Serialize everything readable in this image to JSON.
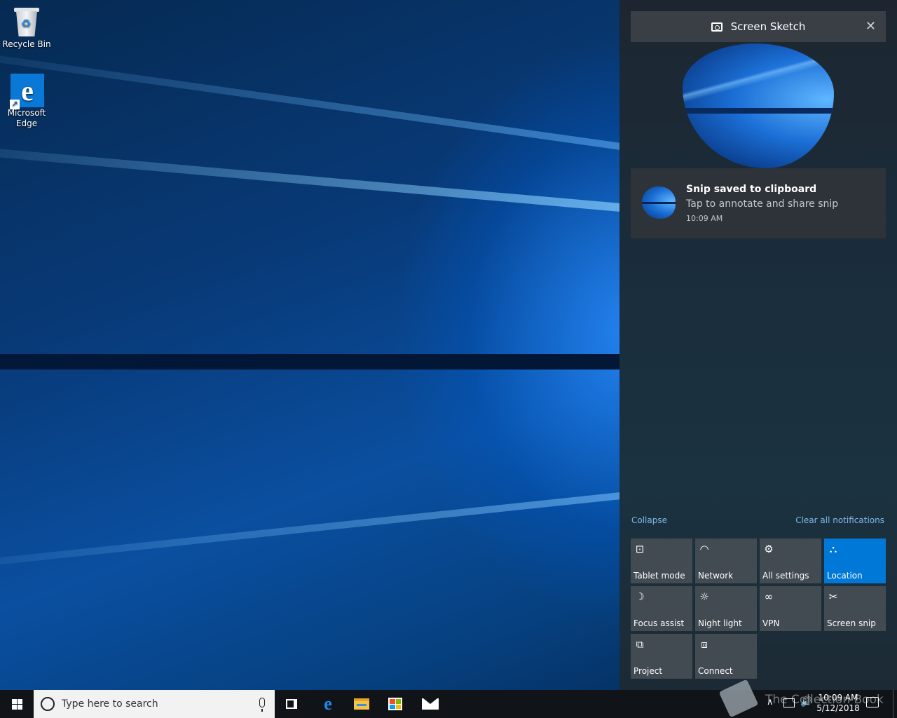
{
  "desktop": {
    "icons": [
      {
        "label": "Recycle Bin"
      },
      {
        "label": "Microsoft\nEdge"
      }
    ]
  },
  "action_center": {
    "group": {
      "app_name": "Screen Sketch",
      "close_glyph": "✕"
    },
    "toast": {
      "title": "Snip saved to clipboard",
      "body": "Tap to annotate and share snip",
      "time": "10:09 AM"
    },
    "collapse_label": "Collapse",
    "clear_all_label": "Clear all notifications",
    "quick_actions": [
      {
        "label": "Tablet mode",
        "icon": "tablet-mode-icon",
        "glyph": "⊡",
        "active": false
      },
      {
        "label": "Network",
        "icon": "network-icon",
        "glyph": "◠",
        "active": false
      },
      {
        "label": "All settings",
        "icon": "gear-icon",
        "glyph": "⚙",
        "active": false
      },
      {
        "label": "Location",
        "icon": "location-icon",
        "glyph": "⛬",
        "active": true
      },
      {
        "label": "Focus assist",
        "icon": "moon-icon",
        "glyph": "☽",
        "active": false
      },
      {
        "label": "Night light",
        "icon": "sun-icon",
        "glyph": "☼",
        "active": false
      },
      {
        "label": "VPN",
        "icon": "vpn-icon",
        "glyph": "∞",
        "active": false
      },
      {
        "label": "Screen snip",
        "icon": "screen-snip-icon",
        "glyph": "✂",
        "active": false
      },
      {
        "label": "Project",
        "icon": "project-icon",
        "glyph": "⧉",
        "active": false
      },
      {
        "label": "Connect",
        "icon": "connect-icon",
        "glyph": "⧈",
        "active": false
      }
    ],
    "accent_color": "#0078d7"
  },
  "taskbar": {
    "search_placeholder": "Type here to search",
    "clock_time": "10:09 AM",
    "clock_date": "5/12/2018",
    "tray_chevron": "∧",
    "volume_glyph": "🔊",
    "edge_glyph": "e",
    "watermark": "The Collection Book"
  }
}
